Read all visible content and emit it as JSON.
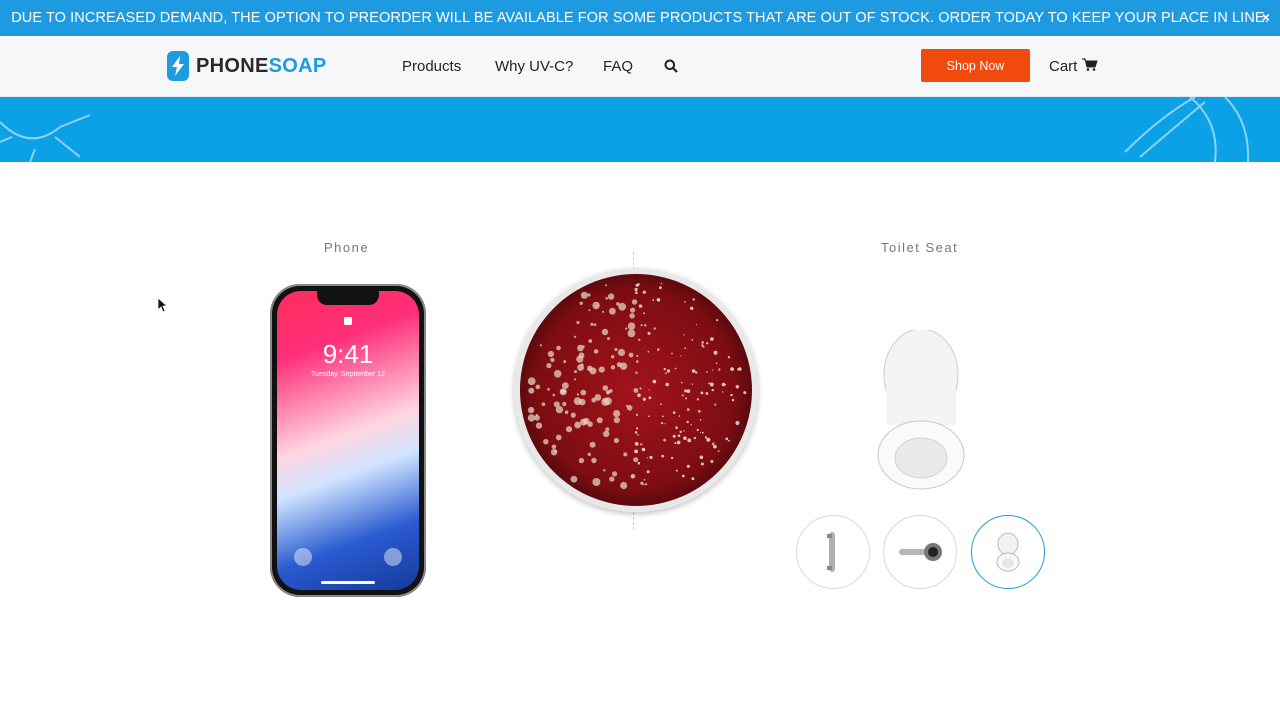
{
  "banner": {
    "text": "DUE TO INCREASED DEMAND, THE OPTION TO PREORDER WILL BE AVAILABLE FOR SOME PRODUCTS THAT ARE OUT OF STOCK. ORDER TODAY TO KEEP YOUR PLACE IN LINE.",
    "close": "×"
  },
  "brand": {
    "part1": "PHONE",
    "part2": "SOAP",
    "color": "#1e9be0"
  },
  "nav": {
    "products": "Products",
    "why": "Why UV-C?",
    "faq": "FAQ"
  },
  "header": {
    "shop_now": "Shop Now",
    "cart": "Cart"
  },
  "compare": {
    "left_label": "Phone",
    "right_label": "Toilet Seat",
    "phone_time": "9:41",
    "phone_date": "Tuesday, September 12",
    "thumbnails": [
      "door-handle",
      "lever-handle",
      "toilet-seat"
    ],
    "active_thumbnail": "toilet-seat"
  },
  "colors": {
    "banner": "#1e9be0",
    "hero": "#0aa1e6",
    "shop_button": "#f04a0c",
    "dish": "#8e0f15"
  }
}
